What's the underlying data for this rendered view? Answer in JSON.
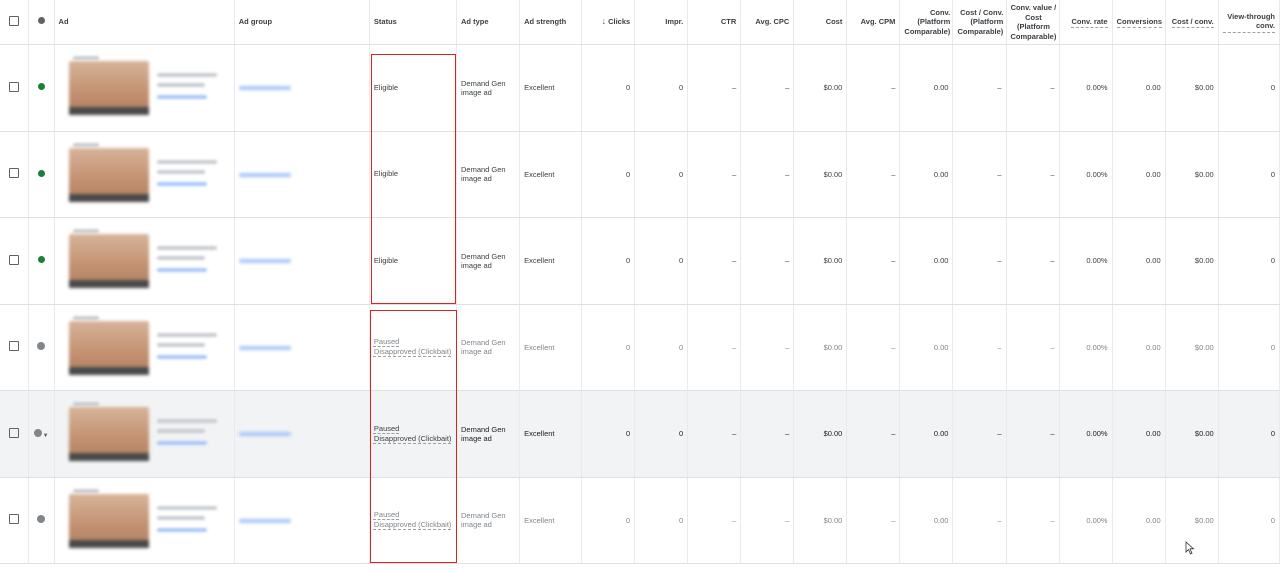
{
  "columns": {
    "ad": "Ad",
    "ad_group": "Ad group",
    "status": "Status",
    "ad_type": "Ad type",
    "ad_strength": "Ad strength",
    "clicks": "Clicks",
    "impr": "Impr.",
    "ctr": "CTR",
    "avg_cpc": "Avg. CPC",
    "cost": "Cost",
    "avg_cpm": "Avg. CPM",
    "conv_platform": "Conv. (Platform Comparable)",
    "cost_conv_platform": "Cost / Conv. (Platform Comparable)",
    "conv_value_cost_platform": "Conv. value / Cost (Platform Comparable)",
    "conv_rate": "Conv. rate",
    "conversions": "Conversions",
    "cost_conv": "Cost / conv.",
    "view_through_conv": "View-through conv."
  },
  "sort": {
    "column": "clicks",
    "direction": "descending",
    "icon": "arrow-down-icon"
  },
  "colors": {
    "eligible": "#188038",
    "paused": "#80868b",
    "highlight_box": "#e0211c",
    "hover_row": "#f1f3f4"
  },
  "rows": [
    {
      "status_icon": "green",
      "status_line1": "Eligible",
      "status_line2": "",
      "ad_type": "Demand Gen image ad",
      "ad_strength": "Excellent",
      "clicks": "0",
      "impr": "0",
      "ctr": "–",
      "avg_cpc": "–",
      "cost": "$0.00",
      "avg_cpm": "–",
      "conv_platform": "0.00",
      "cost_conv_platform": "–",
      "conv_value_cost_platform": "–",
      "conv_rate": "0.00%",
      "conversions": "0.00",
      "cost_conv": "$0.00",
      "view_through_conv": "0"
    },
    {
      "status_icon": "green",
      "status_line1": "Eligible",
      "status_line2": "",
      "ad_type": "Demand Gen image ad",
      "ad_strength": "Excellent",
      "clicks": "0",
      "impr": "0",
      "ctr": "–",
      "avg_cpc": "–",
      "cost": "$0.00",
      "avg_cpm": "–",
      "conv_platform": "0.00",
      "cost_conv_platform": "–",
      "conv_value_cost_platform": "–",
      "conv_rate": "0.00%",
      "conversions": "0.00",
      "cost_conv": "$0.00",
      "view_through_conv": "0"
    },
    {
      "status_icon": "green",
      "status_line1": "Eligible",
      "status_line2": "",
      "ad_type": "Demand Gen image ad",
      "ad_strength": "Excellent",
      "clicks": "0",
      "impr": "0",
      "ctr": "–",
      "avg_cpc": "–",
      "cost": "$0.00",
      "avg_cpm": "–",
      "conv_platform": "0.00",
      "cost_conv_platform": "–",
      "conv_value_cost_platform": "–",
      "conv_rate": "0.00%",
      "conversions": "0.00",
      "cost_conv": "$0.00",
      "view_through_conv": "0"
    },
    {
      "status_icon": "paused",
      "status_line1": "Paused",
      "status_line2": "Disapproved (Clickbait)",
      "ad_type": "Demand Gen image ad",
      "ad_strength": "Excellent",
      "clicks": "0",
      "impr": "0",
      "ctr": "–",
      "avg_cpc": "–",
      "cost": "$0.00",
      "avg_cpm": "–",
      "conv_platform": "0.00",
      "cost_conv_platform": "–",
      "conv_value_cost_platform": "–",
      "conv_rate": "0.00%",
      "conversions": "0.00",
      "cost_conv": "$0.00",
      "view_through_conv": "0"
    },
    {
      "status_icon": "paused",
      "status_line1": "Paused",
      "status_line2": "Disapproved (Clickbait)",
      "ad_type": "Demand Gen image ad",
      "ad_strength": "Excellent",
      "clicks": "0",
      "impr": "0",
      "ctr": "–",
      "avg_cpc": "–",
      "cost": "$0.00",
      "avg_cpm": "–",
      "conv_platform": "0.00",
      "cost_conv_platform": "–",
      "conv_value_cost_platform": "–",
      "conv_rate": "0.00%",
      "conversions": "0.00",
      "cost_conv": "$0.00",
      "view_through_conv": "0"
    },
    {
      "status_icon": "paused",
      "status_line1": "Paused",
      "status_line2": "Disapproved (Clickbait)",
      "ad_type": "Demand Gen image ad",
      "ad_strength": "Excellent",
      "clicks": "0",
      "impr": "0",
      "ctr": "–",
      "avg_cpc": "–",
      "cost": "$0.00",
      "avg_cpm": "–",
      "conv_platform": "0.00",
      "cost_conv_platform": "–",
      "conv_value_cost_platform": "–",
      "conv_rate": "0.00%",
      "conversions": "0.00",
      "cost_conv": "$0.00",
      "view_through_conv": "0"
    }
  ]
}
